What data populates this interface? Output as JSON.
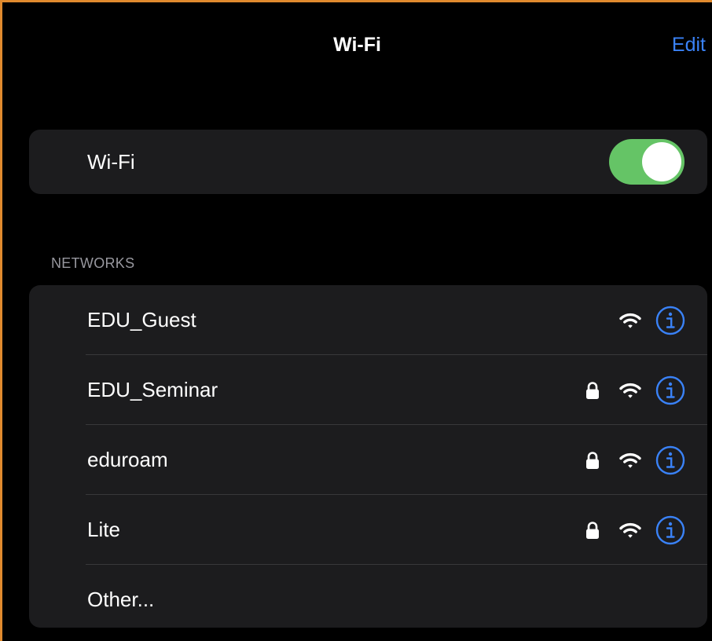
{
  "navbar": {
    "title": "Wi-Fi",
    "edit_label": "Edit"
  },
  "wifi_toggle": {
    "label": "Wi-Fi",
    "enabled": true,
    "on_color": "#65c466"
  },
  "networks_section": {
    "header": "NETWORKS",
    "items": [
      {
        "name": "EDU_Guest",
        "locked": false,
        "icons": [
          "wifi-icon",
          "info-icon"
        ]
      },
      {
        "name": "EDU_Seminar",
        "locked": true,
        "icons": [
          "lock-icon",
          "wifi-icon",
          "info-icon"
        ]
      },
      {
        "name": "eduroam",
        "locked": true,
        "icons": [
          "lock-icon",
          "wifi-icon",
          "info-icon"
        ]
      },
      {
        "name": "Lite",
        "locked": true,
        "icons": [
          "lock-icon",
          "wifi-icon",
          "info-icon"
        ]
      }
    ],
    "other_label": "Other..."
  },
  "colors": {
    "accent": "#3a82f7",
    "background": "#000000",
    "group_background": "#1c1c1e"
  }
}
